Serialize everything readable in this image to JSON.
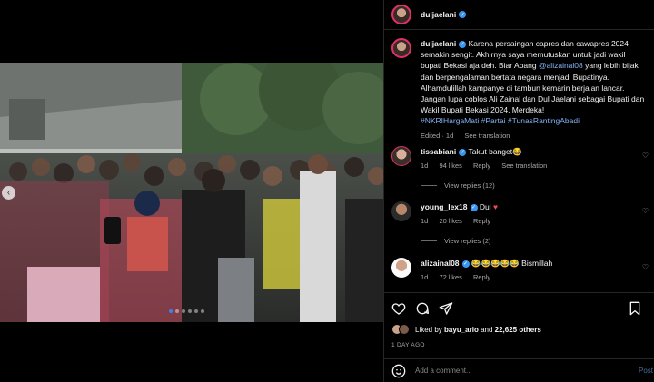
{
  "post": {
    "author": "duljaelani",
    "caption_username": "duljaelani",
    "caption_parts": {
      "p1": "Karena persaingan capres dan cawapres 2024 semakin sengit. Akhirnya saya memutuskan untuk jadi wakil bupati Bekasi aja deh. Biar Abang ",
      "mention": "@alizainal08",
      "p2": " yang lebih bijak dan berpengalaman bertata negara menjadi Bupatinya. Alhamdulillah kampanye di tambun kemarin berjalan lancar. Jangan lupa coblos Ali Zainal dan Dul Jaelani sebagai Bupati dan Wakil Bupati Bekasi 2024. Merdeka!",
      "hashtags": "#NKRIHargaMati #Partai #TunasRantingAbadi"
    },
    "caption_meta_edited": "Edited · 1d",
    "caption_meta_translation": "See translation",
    "carousel": {
      "total": 6,
      "active": 1
    }
  },
  "comments": [
    {
      "username": "tissabiani",
      "text": "Takut banget😂",
      "time": "1d",
      "likes": "94 likes",
      "reply": "Reply",
      "translation": "See translation",
      "view_replies": "View replies (12)"
    },
    {
      "username": "young_lex18",
      "text": "Dul",
      "time": "1d",
      "likes": "20 likes",
      "reply": "Reply",
      "view_replies": "View replies (2)"
    },
    {
      "username": "alizainal08",
      "text": "😂😂😂😂😂 Bismillah",
      "time": "1d",
      "likes": "72 likes",
      "reply": "Reply"
    }
  ],
  "engagement": {
    "liked_by_prefix": "Liked by",
    "liked_by_user": "bayu_ario",
    "and": "and",
    "others": "22,625 others",
    "date": "1 DAY AGO"
  },
  "composer": {
    "placeholder": "Add a comment...",
    "post_label": "Post"
  },
  "icons": {
    "like": "heart-icon",
    "comment": "comment-icon",
    "share": "share-icon",
    "save": "bookmark-icon",
    "emoji": "emoji-icon",
    "verified": "verified-badge-icon",
    "prev": "chevron-left-icon"
  },
  "colors": {
    "accent": "#3897f0",
    "link": "#82b4f5",
    "background": "#000000",
    "heart_red": "#ed4956"
  }
}
